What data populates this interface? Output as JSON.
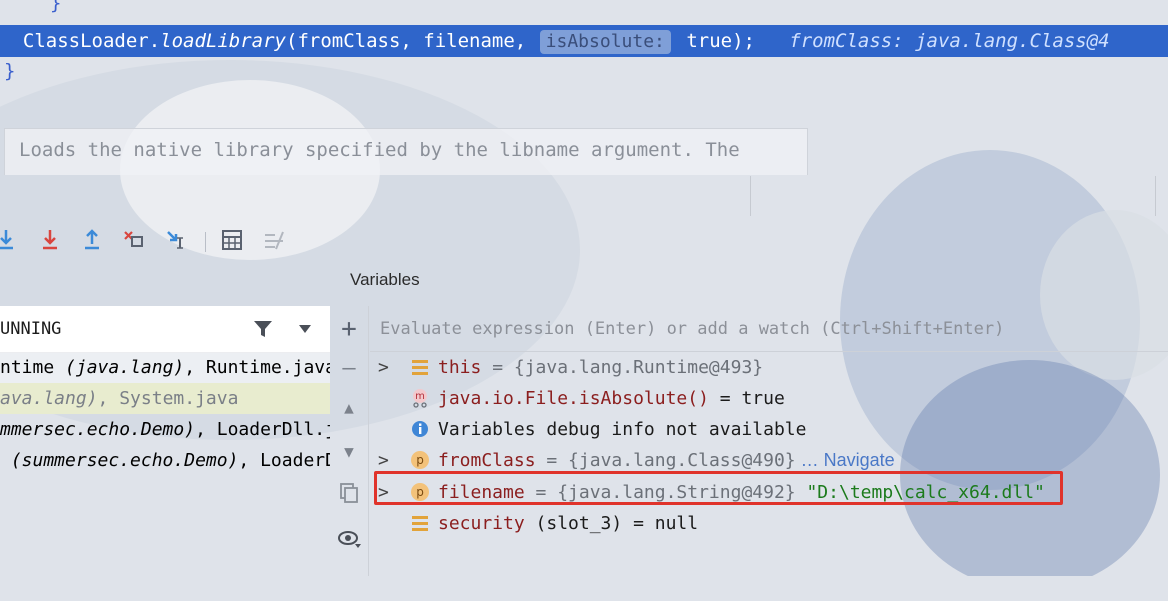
{
  "editor": {
    "code_line": {
      "prefix": "  ClassLoader.",
      "method": "loadLibrary",
      "args_before": "(fromClass, filename, ",
      "param_hint": "isAbsolute:",
      "args_after": " true);",
      "inline_value": "   fromClass: java.lang.Class@4"
    },
    "doc_line": "Loads the native library specified by the libname argument. The"
  },
  "toolbar": {
    "icons": [
      "step-over-icon",
      "force-step-into-icon",
      "step-out-icon",
      "drop-frame-icon",
      "run-to-cursor-icon",
      "evaluate-icon",
      "trace-icon"
    ]
  },
  "frames": {
    "thread_label": "UNNING",
    "rows": [
      {
        "a": "ntime ",
        "b": "(java.lang)",
        "c": ", Runtime.java"
      },
      {
        "a": "",
        "b": "ava.lang)",
        "c": ", System.java"
      },
      {
        "a": "",
        "b": "mmersec.echo.Demo)",
        "c": ", LoaderDll.j"
      },
      {
        "a": "",
        "b": " (summersec.echo.Demo)",
        "c": ", LoaderD"
      }
    ]
  },
  "variables": {
    "title": "Variables",
    "eval_placeholder": "Evaluate expression (Enter) or add a watch (Ctrl+Shift+Enter)",
    "rows": [
      {
        "name": "this",
        "value": " = {java.lang.Runtime@493}"
      },
      {
        "name": "java.io.File.isAbsolute()",
        "value": " = true"
      },
      {
        "text": "Variables debug info not available"
      },
      {
        "name": "fromClass",
        "value": " = {java.lang.Class@490}",
        "link": " … Navigate"
      },
      {
        "name": "filename",
        "value": " = {java.lang.String@492} ",
        "str": "\"D:\\temp\\calc_x64.dll\""
      },
      {
        "name": "security",
        "value": " (slot_3) = null"
      }
    ]
  },
  "colors": {
    "selection": "#2f65ca",
    "highlight_box": "#e0332b"
  }
}
